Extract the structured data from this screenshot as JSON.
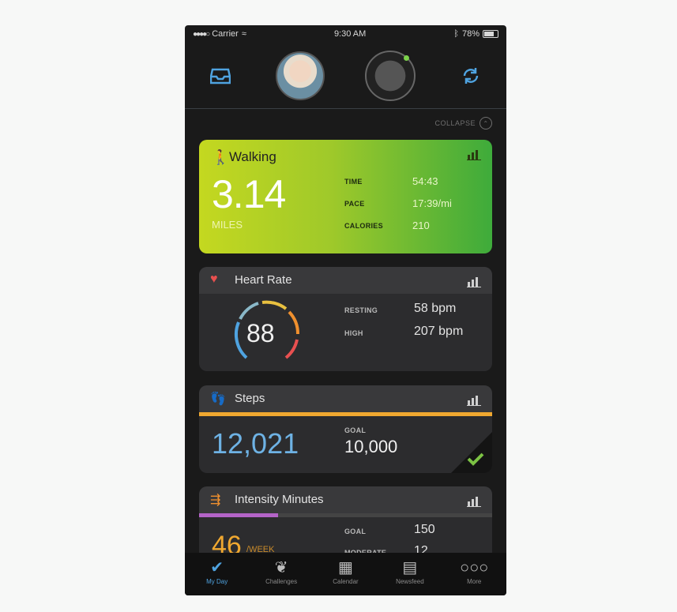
{
  "status": {
    "carrier": "Carrier",
    "time": "9:30 AM",
    "battery": "78%"
  },
  "header": {
    "inbox_icon": "inbox-icon",
    "sync_icon": "sync-icon"
  },
  "collapse_label": "COLLAPSE",
  "walking": {
    "title": "Walking",
    "value": "3.14",
    "unit": "MILES",
    "stats": [
      {
        "label": "TIME",
        "value": "54:43"
      },
      {
        "label": "PACE",
        "value": "17:39/mi"
      },
      {
        "label": "CALORIES",
        "value": "210"
      }
    ]
  },
  "heart_rate": {
    "title": "Heart Rate",
    "value": "88",
    "stats": [
      {
        "label": "RESTING",
        "value": "58 bpm"
      },
      {
        "label": "HIGH",
        "value": "207 bpm"
      }
    ]
  },
  "steps": {
    "title": "Steps",
    "value": "12,021",
    "goal_label": "GOAL",
    "goal_value": "10,000",
    "progress": 1.0
  },
  "intensity": {
    "title": "Intensity Minutes",
    "value": "46",
    "unit": "/WEEK",
    "progress": 0.27,
    "stats": [
      {
        "label": "GOAL",
        "value": "150"
      },
      {
        "label": "MODERATE",
        "value": "12"
      }
    ]
  },
  "tabs": [
    {
      "label": "My Day",
      "icon": "checkmark-icon"
    },
    {
      "label": "Challenges",
      "icon": "laurel-icon"
    },
    {
      "label": "Calendar",
      "icon": "calendar-icon"
    },
    {
      "label": "Newsfeed",
      "icon": "newsfeed-icon"
    },
    {
      "label": "More",
      "icon": "more-icon"
    }
  ],
  "colors": {
    "walking_start": "#c4d820",
    "walking_end": "#3eab3b",
    "steps_bar": "#f0a830",
    "intensity_bar": "#b464c8",
    "active_tab": "#4fa3e0"
  }
}
